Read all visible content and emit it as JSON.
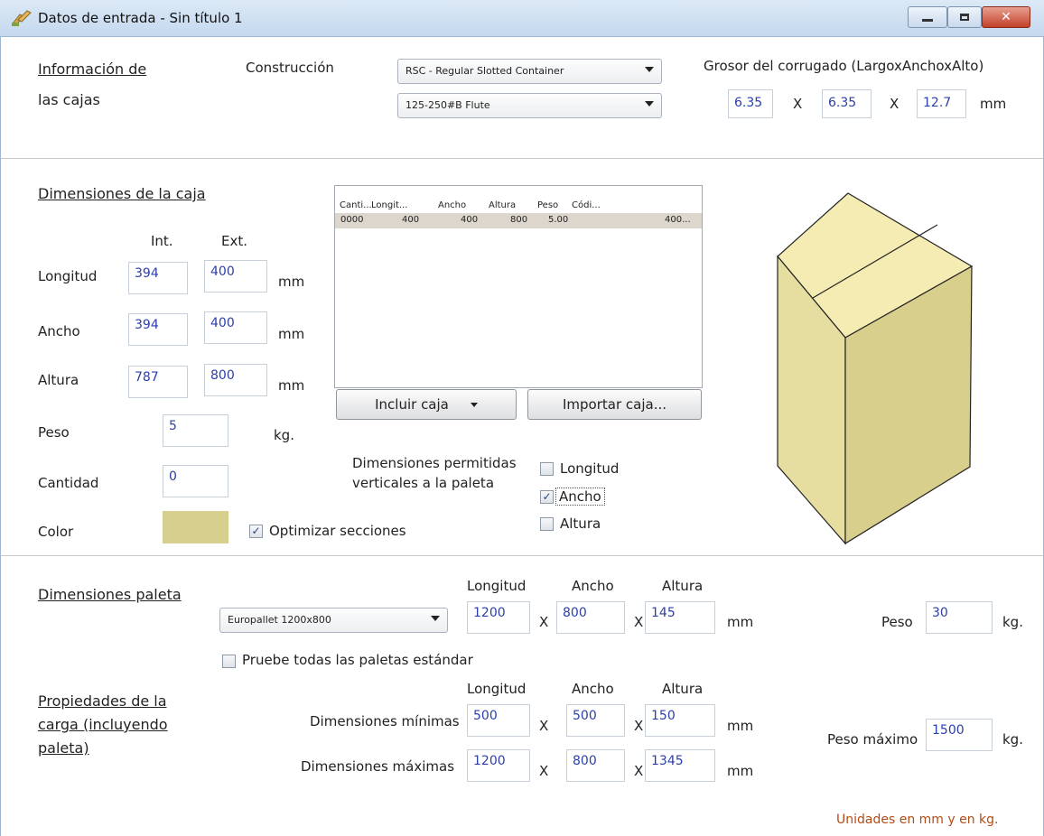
{
  "window": {
    "title": "Datos de entrada - Sin título 1"
  },
  "info": {
    "heading_line1": "Información de",
    "heading_line2": "las cajas",
    "construction_label": "Construcción",
    "construction_value": "RSC - Regular Slotted Container",
    "flute_value": "125-250#B Flute",
    "thickness_label": "Grosor del corrugado (LargoxAnchoxAlto)",
    "thickness_l": "6.35",
    "thickness_w": "6.35",
    "thickness_h": "12.7",
    "x": "X",
    "unit": "mm"
  },
  "box": {
    "heading": "Dimensiones de la caja",
    "int_label": "Int.",
    "ext_label": "Ext.",
    "length_label": "Longitud",
    "width_label": "Ancho",
    "height_label": "Altura",
    "weight_label": "Peso",
    "qty_label": "Cantidad",
    "color_label": "Color",
    "length_int": "394",
    "length_ext": "400",
    "width_int": "394",
    "width_ext": "400",
    "height_int": "787",
    "height_ext": "800",
    "weight": "5",
    "qty": "0",
    "mm": "mm",
    "kg": "kg.",
    "color": "#d6cf8e",
    "optimize_label": "Optimizar secciones",
    "optimize_checked": true
  },
  "grid": {
    "headers": [
      "Canti...",
      "Longit...",
      "Ancho",
      "Altura",
      "Peso",
      "Códi..."
    ],
    "rows": [
      [
        "0000",
        "400",
        "400",
        "800",
        "5.00",
        "400..."
      ]
    ]
  },
  "buttons": {
    "include": "Incluir caja",
    "import": "Importar caja..."
  },
  "vertical": {
    "label_line1": "Dimensiones permitidas",
    "label_line2": "verticales a la paleta",
    "options": [
      {
        "label": "Longitud",
        "checked": false
      },
      {
        "label": "Ancho",
        "checked": true
      },
      {
        "label": "Altura",
        "checked": false
      }
    ]
  },
  "pallet": {
    "heading": "Dimensiones paleta",
    "combo_value": "Europallet 1200x800",
    "col_length": "Longitud",
    "col_width": "Ancho",
    "col_height": "Altura",
    "length": "1200",
    "width": "800",
    "height": "145",
    "x": "X",
    "mm": "mm",
    "weight_label": "Peso",
    "weight": "30",
    "kg": "kg.",
    "try_all_label": "Pruebe todas las paletas estándar",
    "try_all_checked": false
  },
  "load": {
    "heading_line1": "Propiedades de la",
    "heading_line2": "carga (incluyendo",
    "heading_line3": "paleta)",
    "col_length": "Longitud",
    "col_width": "Ancho",
    "col_height": "Altura",
    "min_label": "Dimensiones mínimas",
    "max_label": "Dimensiones máximas",
    "min_l": "500",
    "min_w": "500",
    "min_h": "150",
    "max_l": "1200",
    "max_w": "800",
    "max_h": "1345",
    "x": "X",
    "mm": "mm",
    "max_weight_label": "Peso máximo",
    "max_weight": "1500",
    "kg": "kg."
  },
  "footer": {
    "units_note": "Unidades en mm y en kg."
  },
  "icons": {
    "app": "boxes-icon",
    "minimize": "minimize-icon",
    "maximize": "maximize-icon",
    "close": "close-icon",
    "dropdown": "chevron-down-icon"
  }
}
